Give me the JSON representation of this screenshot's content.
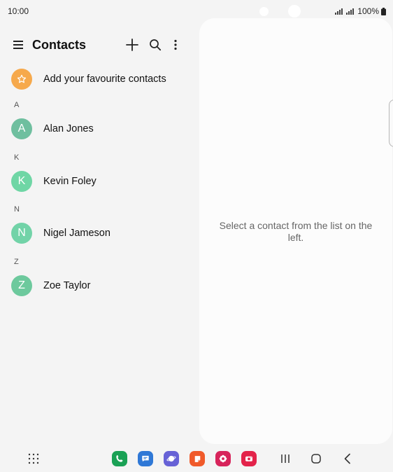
{
  "status_bar": {
    "time": "10:00",
    "battery": "100%"
  },
  "toolbar": {
    "title": "Contacts",
    "menu_icon": "hamburger-icon",
    "add_icon": "plus-icon",
    "search_icon": "search-icon",
    "more_icon": "more-vert-icon"
  },
  "favourites": {
    "label": "Add your favourite contacts",
    "icon": "star-icon",
    "color": "#f6a94c"
  },
  "contacts": [
    {
      "section": "A",
      "initial": "A",
      "name": "Alan Jones",
      "color": "#6fbf9f"
    },
    {
      "section": "K",
      "initial": "K",
      "name": "Kevin Foley",
      "color": "#6fd6a5"
    },
    {
      "section": "N",
      "initial": "N",
      "name": "Nigel Jameson",
      "color": "#72d3a8"
    },
    {
      "section": "Z",
      "initial": "Z",
      "name": "Zoe Taylor",
      "color": "#6dc99d"
    }
  ],
  "detail_pane": {
    "message": "Select a contact from the list on the left."
  },
  "taskbar": {
    "apps": [
      {
        "name": "phone-icon",
        "color": "#1aa155"
      },
      {
        "name": "messages-icon",
        "color": "#2f78d6"
      },
      {
        "name": "internet-icon",
        "color": "#6762d6"
      },
      {
        "name": "notes-icon",
        "color": "#f05a2a"
      },
      {
        "name": "gallery-icon",
        "color": "#d7245b"
      },
      {
        "name": "camera-icon",
        "color": "#e3234a"
      }
    ]
  }
}
